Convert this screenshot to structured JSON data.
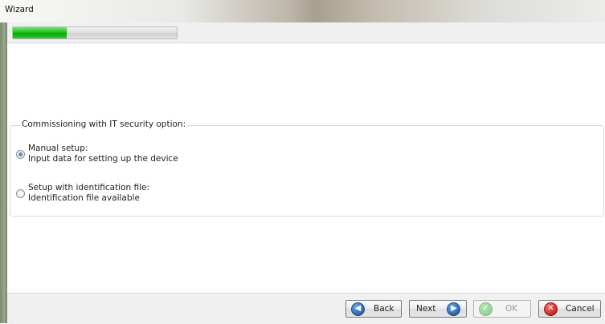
{
  "window": {
    "title": "Wizard"
  },
  "progress": {
    "value": 0.33
  },
  "group": {
    "title": "Commissioning with IT security option:",
    "options": [
      {
        "line1": "Manual setup:",
        "line2": "Input data for setting up the device",
        "selected": true
      },
      {
        "line1": "Setup with identification file:",
        "line2": "Identification file available",
        "selected": false
      }
    ]
  },
  "buttons": {
    "back": {
      "label": "Back",
      "icon": "arrow-left-icon"
    },
    "next": {
      "label": "Next",
      "icon": "arrow-right-icon"
    },
    "ok": {
      "label": "OK",
      "icon": "check-icon",
      "disabled": true
    },
    "cancel": {
      "label": "Cancel",
      "icon": "close-icon"
    }
  },
  "colors": {
    "progress": "#05a905",
    "nav_icon": "#1f5ba8",
    "cancel_icon": "#c81c1c",
    "ok_icon": "#8fcf8f"
  }
}
